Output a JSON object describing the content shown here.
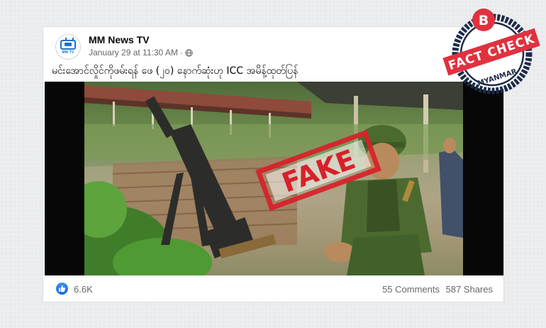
{
  "post": {
    "page_name": "MM News TV",
    "avatar_text": "MM TV",
    "date": "January 29 at 11:30 AM",
    "separator": "·",
    "caption": "မင်းအောင်လှိုင်ကိုဖမ်းရန် ဖေ (၂၀) နောက်ဆုံးဟု ICC အမိန့်ထုတ်ပြန်",
    "stamp_text": "FAKE",
    "reactions": "6.6K",
    "comments": "55 Comments",
    "shares": "587 Shares"
  },
  "badge": {
    "letter": "B",
    "text": "FACT CHECK",
    "subtext": "MYANMAR"
  },
  "colors": {
    "badge_red": "#e0323e",
    "badge_navy": "#1d2b4a",
    "link_blue": "#1877f2",
    "stamp_red": "#d8202a"
  }
}
